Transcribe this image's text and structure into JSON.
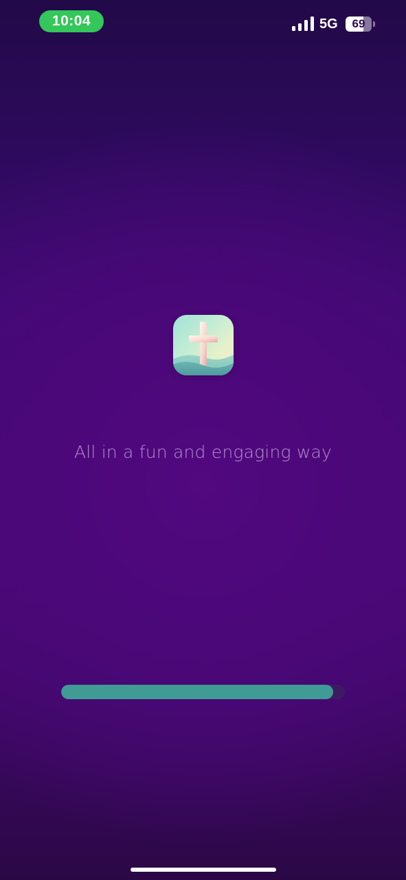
{
  "status_bar": {
    "time": "10:04",
    "network": "5G",
    "battery_level": "69",
    "battery_fraction": 0.69,
    "signal_bars": 4,
    "signal_icon": "cellular-signal-icon",
    "battery_icon": "battery-icon"
  },
  "splash": {
    "logo_icon": "cross-app-logo-icon",
    "tagline": "All in a fun and engaging way"
  },
  "loading": {
    "progress": 0.96
  },
  "colors": {
    "time_pill": "#34c759",
    "progress_fill": "#3f9b94",
    "background_top": "#220948",
    "background_mid": "#4a0878"
  }
}
